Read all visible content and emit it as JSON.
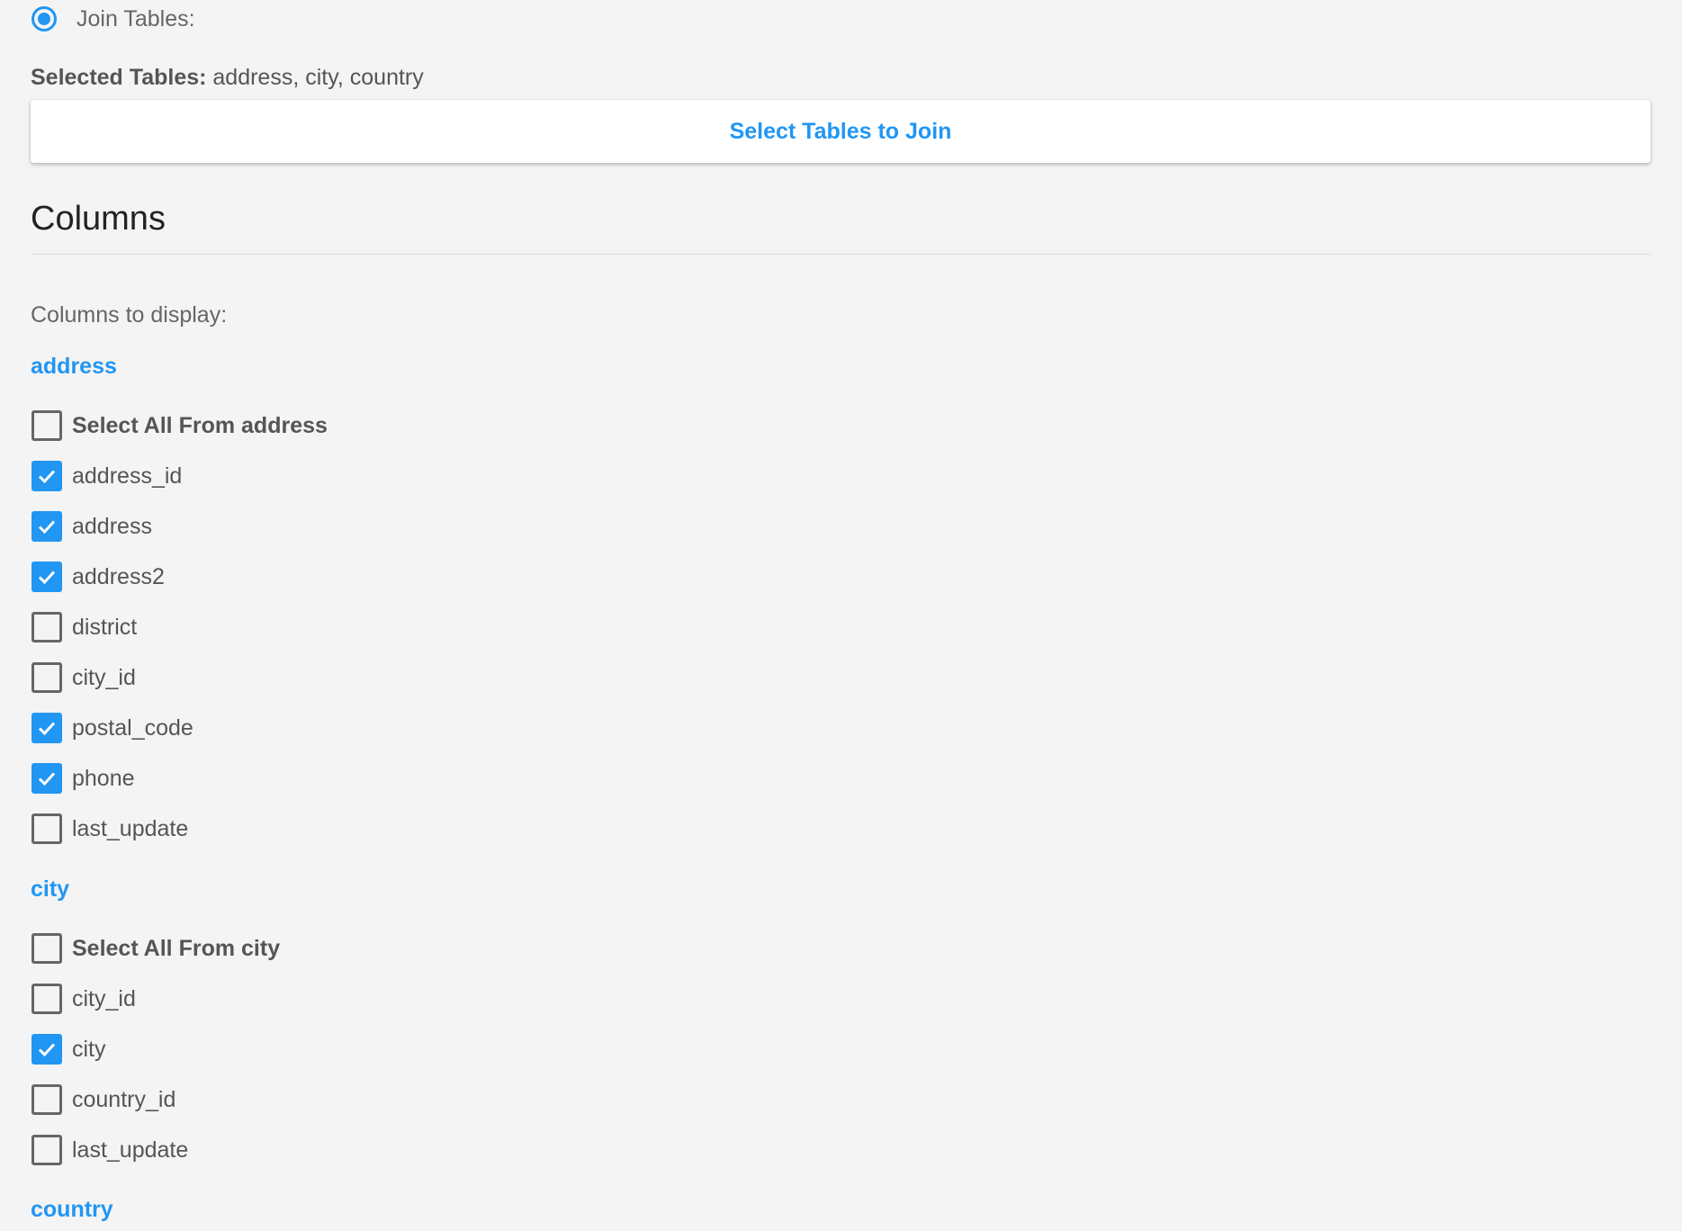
{
  "join": {
    "radio_label": "Join Tables:",
    "selected_prefix": "Selected Tables:",
    "selected_value": " address, city, country",
    "button_label": "Select Tables to Join"
  },
  "columns": {
    "title": "Columns",
    "display_label": "Columns to display:"
  },
  "tables": [
    {
      "name": "address",
      "select_all": "Select All From address",
      "select_all_checked": false,
      "fields": [
        {
          "label": "address_id",
          "checked": true
        },
        {
          "label": "address",
          "checked": true
        },
        {
          "label": "address2",
          "checked": true
        },
        {
          "label": "district",
          "checked": false
        },
        {
          "label": "city_id",
          "checked": false
        },
        {
          "label": "postal_code",
          "checked": true
        },
        {
          "label": "phone",
          "checked": true
        },
        {
          "label": "last_update",
          "checked": false
        }
      ]
    },
    {
      "name": "city",
      "select_all": "Select All From city",
      "select_all_checked": false,
      "fields": [
        {
          "label": "city_id",
          "checked": false
        },
        {
          "label": "city",
          "checked": true
        },
        {
          "label": "country_id",
          "checked": false
        },
        {
          "label": "last_update",
          "checked": false
        }
      ]
    },
    {
      "name": "country"
    }
  ],
  "colors": {
    "accent": "#2196f3",
    "background": "#f4f4f4"
  },
  "icons": {
    "radio": "radio-selected-icon",
    "checkbox_checked": "checkmark-icon"
  }
}
